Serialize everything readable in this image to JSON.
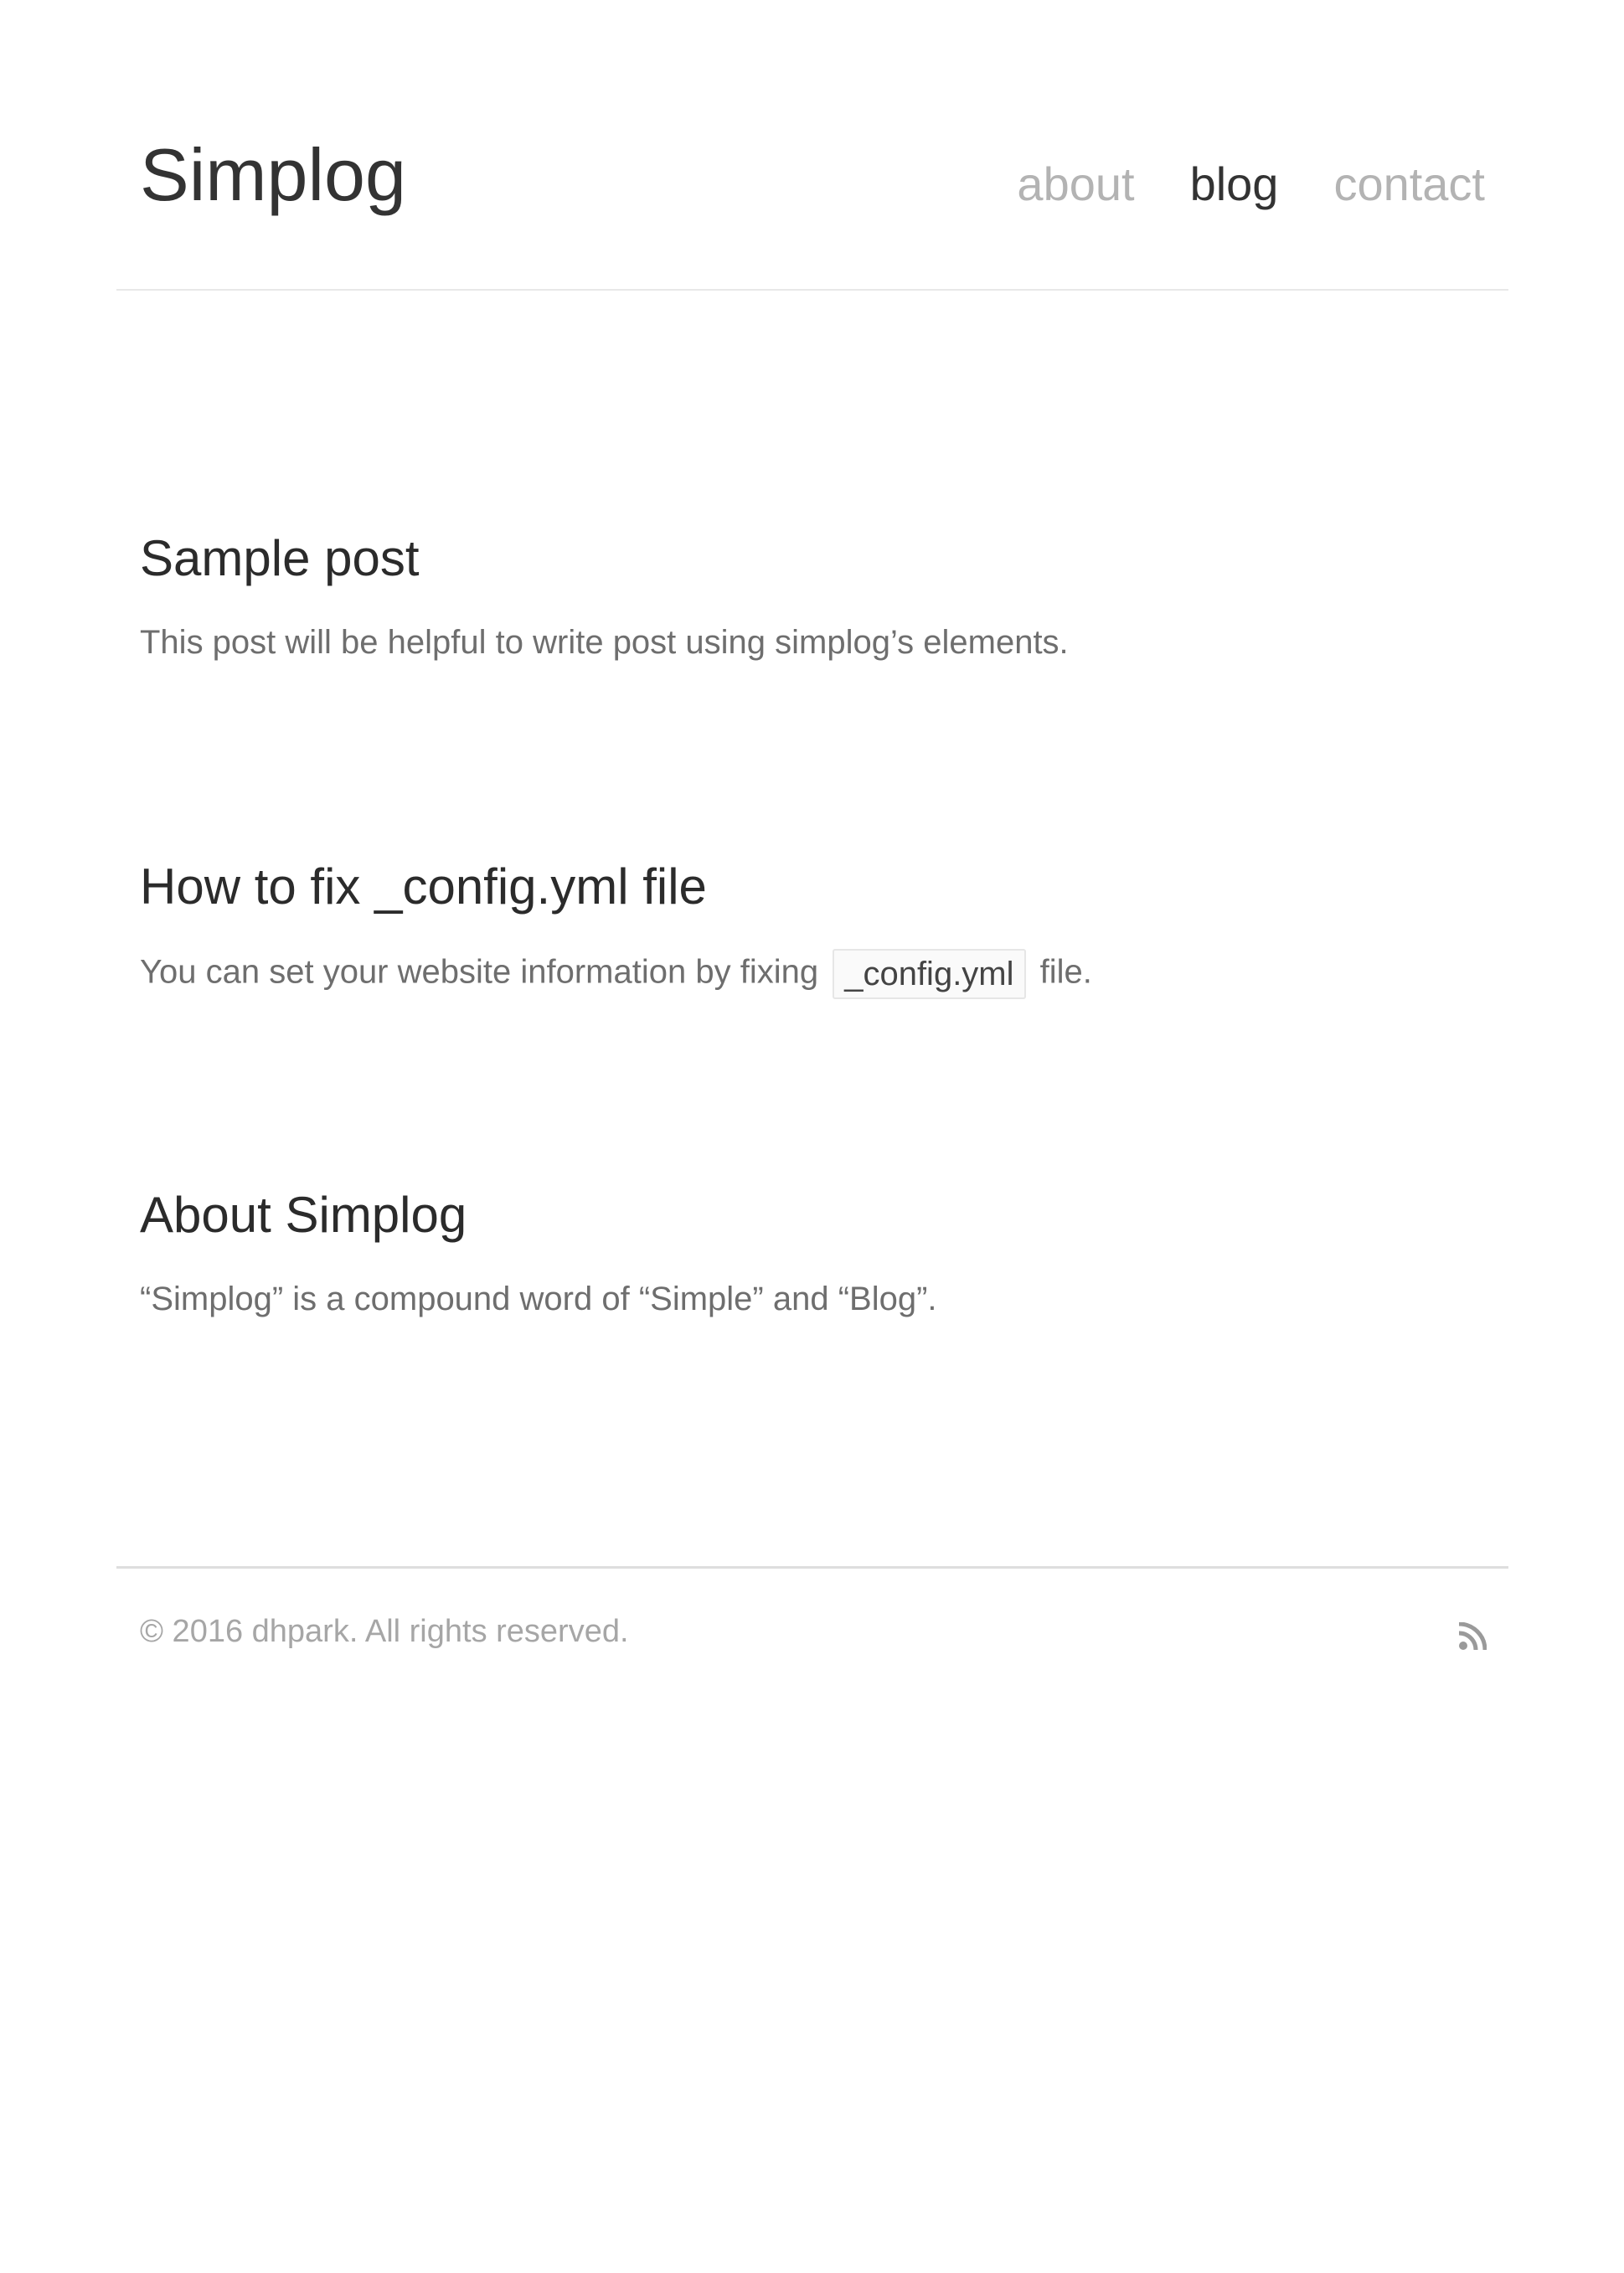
{
  "header": {
    "site_title": "Simplog",
    "nav": [
      {
        "label": "about",
        "active": false
      },
      {
        "label": "blog",
        "active": true
      },
      {
        "label": "contact",
        "active": false
      }
    ]
  },
  "posts": [
    {
      "title": "Sample post",
      "excerpt": "This post will be helpful to write post using simplog’s elements."
    },
    {
      "title": "How to fix _config.yml file",
      "excerpt_before": "You can set your website information by fixing",
      "excerpt_code": "_config.yml",
      "excerpt_after": "file."
    },
    {
      "title": "About Simplog",
      "excerpt": "“Simplog” is a compound word of “Simple” and “Blog”."
    }
  ],
  "footer": {
    "copyright": "© 2016 dhpark. All rights reserved.",
    "rss_icon": "rss-icon"
  },
  "colors": {
    "text": "#333333",
    "nav_inactive": "#b3b3b3",
    "excerpt": "#6e6e6e",
    "footer_text": "#a6a6a6",
    "divider": "#e8e8e8"
  }
}
